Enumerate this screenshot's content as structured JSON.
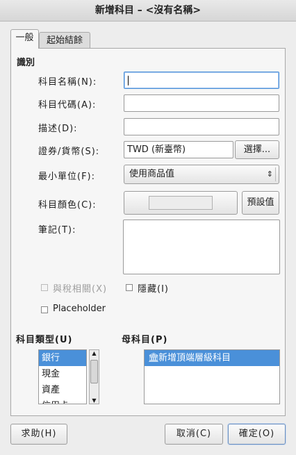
{
  "window": {
    "title": "新增科目 – <沒有名稱>"
  },
  "tabs": [
    {
      "label": "一般"
    },
    {
      "label": "起始結餘"
    }
  ],
  "identification": {
    "section_title": "識別",
    "name_label": "科目名稱(N):",
    "name_value": "",
    "code_label": "科目代碼(A):",
    "code_value": "",
    "description_label": "描述(D):",
    "description_value": "",
    "security_label": "證券/貨幣(S):",
    "security_value": "TWD (新臺幣)",
    "select_button": "選擇...",
    "smallest_unit_label": "最小單位(F):",
    "smallest_unit_value": "使用商品值",
    "color_label": "科目顏色(C):",
    "default_button": "預設值",
    "notes_label": "筆記(T):",
    "notes_value": "",
    "tax_related_label": "與稅相關(X)",
    "hidden_label": "隱藏(I)",
    "placeholder_label": "Placeholder"
  },
  "account_type": {
    "section_title": "科目類型(U)",
    "items": [
      "銀行",
      "現金",
      "資產",
      "信用卡"
    ],
    "selected": "銀行"
  },
  "parent_account": {
    "section_title": "母科目(P)",
    "items": [
      "新增頂端層級科目"
    ]
  },
  "footer": {
    "help_button": "求助(H)",
    "cancel_button": "取消(C)",
    "ok_button": "確定(O)"
  },
  "colors": {
    "selection": "#4a90d9",
    "window_bg": "#ededed"
  }
}
